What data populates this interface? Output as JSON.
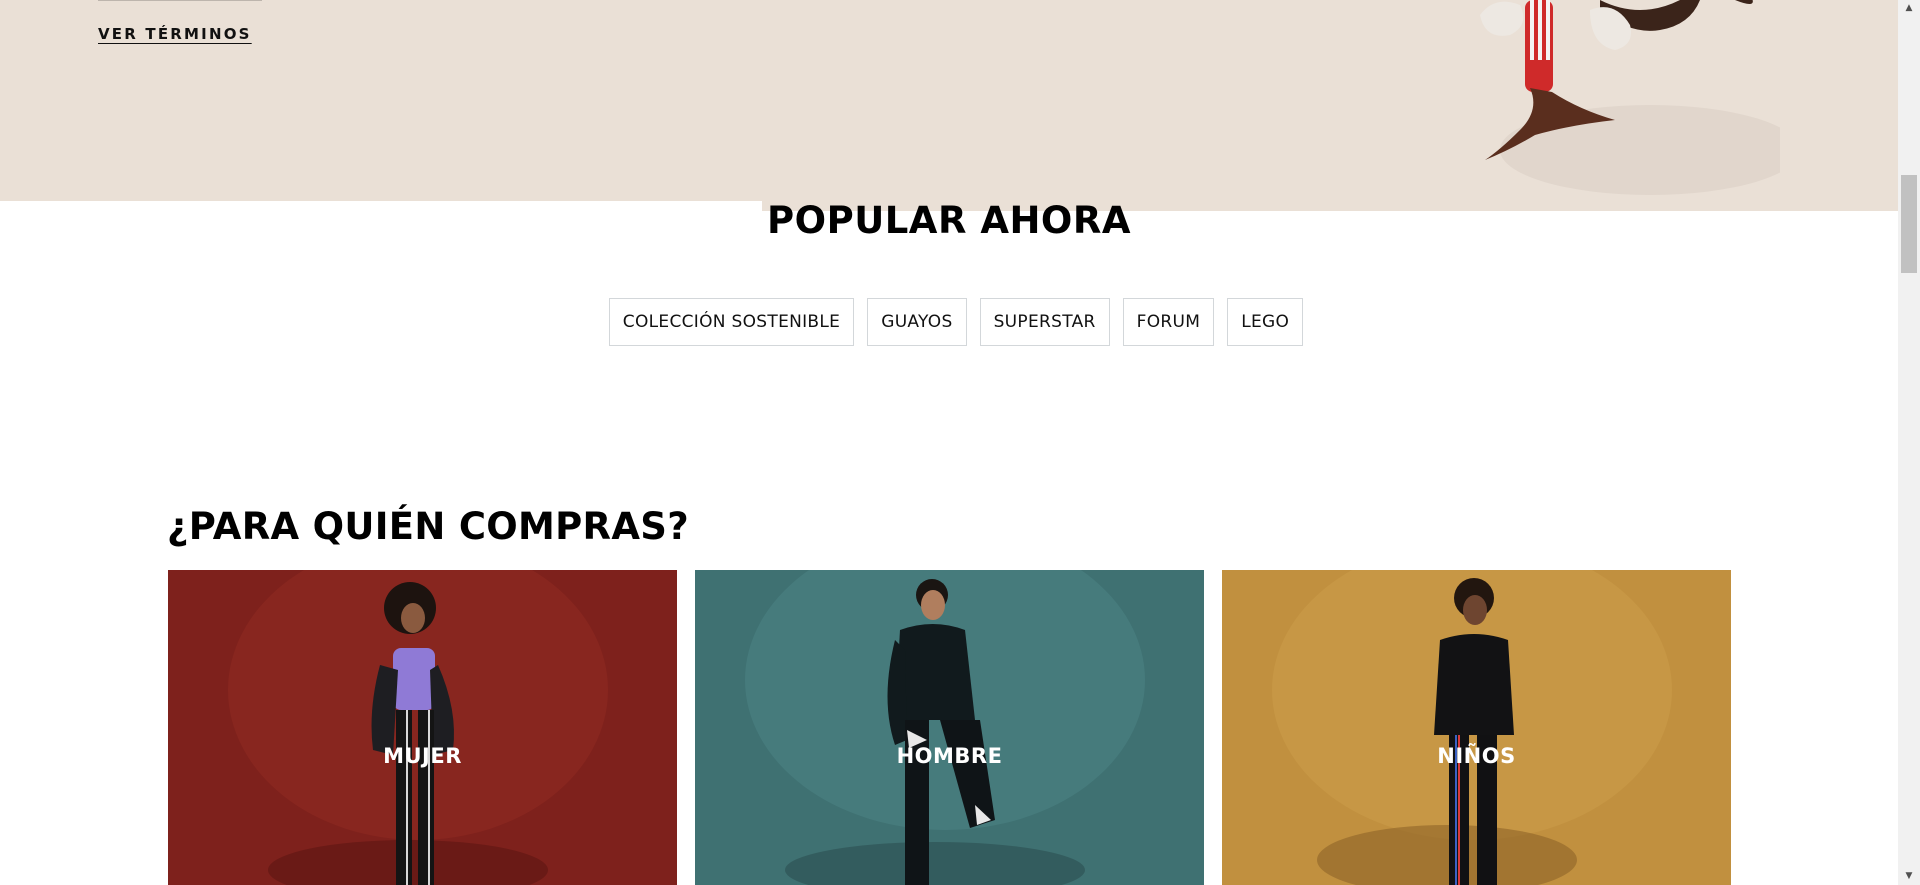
{
  "hero": {
    "terms_link": "VER TÉRMINOS"
  },
  "popular": {
    "title": "POPULAR AHORA",
    "chips": [
      "COLECCIÓN SOSTENIBLE",
      "GUAYOS",
      "SUPERSTAR",
      "FORUM",
      "LEGO"
    ]
  },
  "shop_for": {
    "title": "¿PARA QUIÉN COMPRAS?",
    "cards": [
      {
        "label": "MUJER",
        "bg": "#7e211c"
      },
      {
        "label": "HOMBRE",
        "bg": "#3f7172"
      },
      {
        "label": "NIÑOS",
        "bg": "#c1903f"
      }
    ]
  },
  "colors": {
    "hero_bg": "#eae0d6",
    "chip_border": "#d3d7da"
  },
  "icons": {
    "scroll_up": "scroll-up-arrow-icon",
    "scroll_down": "scroll-down-arrow-icon"
  }
}
